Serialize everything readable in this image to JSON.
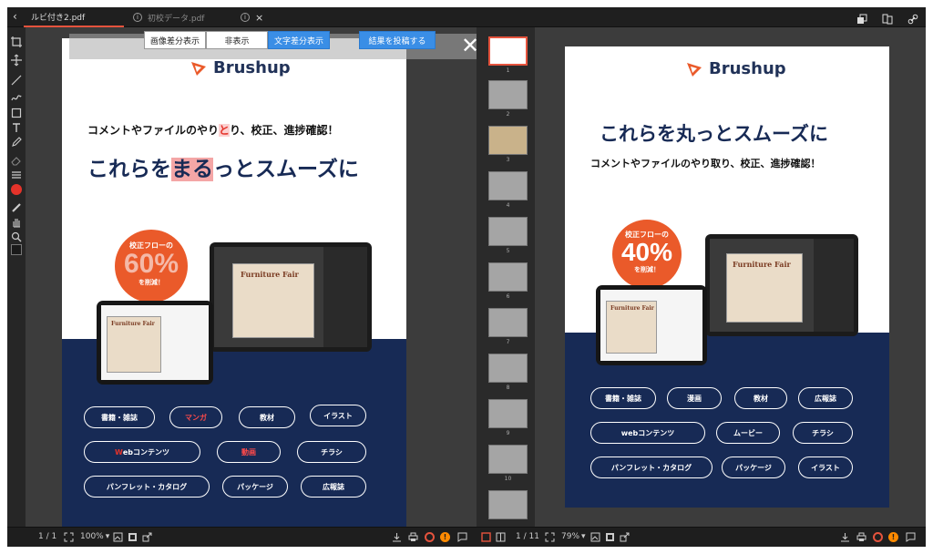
{
  "tabs": [
    {
      "label": "ルビ付き2.pdf"
    },
    {
      "label": "初校データ.pdf"
    }
  ],
  "overlay": {
    "buttons": [
      "画像差分表示",
      "非表示",
      "文字差分表示"
    ],
    "post_button": "結果を投稿する"
  },
  "left_doc": {
    "logo": "Brushup",
    "subtitle_a": "コメントやファイルのやり",
    "subtitle_b": "と",
    "subtitle_c": "り、校正、進捗確認！",
    "headline_a": "これらを",
    "headline_b": "まる",
    "headline_c": "っとスムーズに",
    "badge_top": "校正フローの",
    "badge_value": "60%",
    "badge_bottom": "を削減！",
    "mock_title": "Furniture Fair",
    "pills_row1": [
      "書籍・雑誌",
      "マンガ",
      "教材",
      "イラスト"
    ],
    "pills_row2_a": "W",
    "pills_row2_b": "ebコンテンツ",
    "pills_row2": [
      "動画",
      "チラシ"
    ],
    "pills_row3": [
      "パンフレット・カタログ",
      "パッケージ",
      "広報誌"
    ]
  },
  "right_doc": {
    "logo": "Brushup",
    "headline": "これらを丸っとスムーズに",
    "subtitle": "コメントやファイルのやり取り、校正、進捗確認！",
    "badge_top": "校正フローの",
    "badge_value": "40%",
    "badge_bottom": "を削減！",
    "mock_title": "Furniture Fair",
    "pills_row1": [
      "書籍・雑誌",
      "漫画",
      "教材",
      "広報誌"
    ],
    "pills_row2": [
      "webコンテンツ",
      "ムービー",
      "チラシ"
    ],
    "pills_row3": [
      "パンフレット・カタログ",
      "パッケージ",
      "イラスト"
    ]
  },
  "thumbnails": [
    "1",
    "2",
    "3",
    "4",
    "5",
    "6",
    "7",
    "8",
    "9",
    "10"
  ],
  "bottom_left": {
    "pages": "1 / 1",
    "zoom": "100%"
  },
  "bottom_right": {
    "pages": "1 / 11",
    "zoom": "79%"
  },
  "colors": {
    "accent": "#e5533d",
    "navy": "#172a55",
    "orange": "#ea5a2a",
    "blue_button": "#3a8ee6"
  }
}
